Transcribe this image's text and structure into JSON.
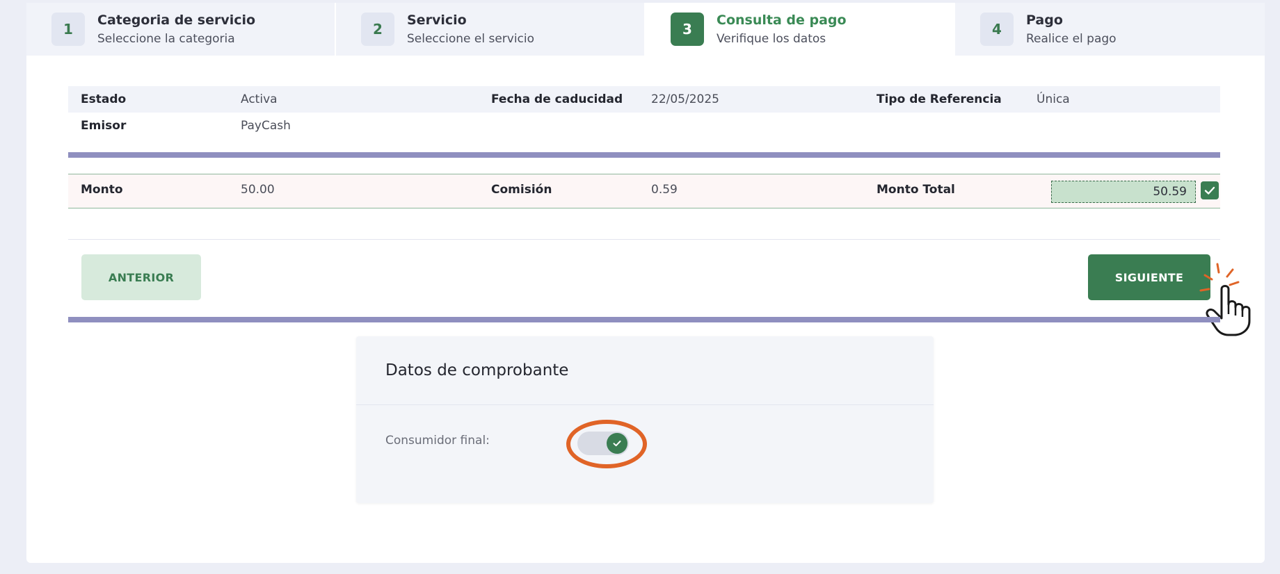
{
  "steps": [
    {
      "num": "1",
      "title": "Categoria de servicio",
      "subtitle": "Seleccione la categoria"
    },
    {
      "num": "2",
      "title": "Servicio",
      "subtitle": "Seleccione el servicio"
    },
    {
      "num": "3",
      "title": "Consulta de pago",
      "subtitle": "Verifique los datos"
    },
    {
      "num": "4",
      "title": "Pago",
      "subtitle": "Realice el pago"
    }
  ],
  "info": {
    "estado_label": "Estado",
    "estado_value": "Activa",
    "fecha_label": "Fecha de caducidad",
    "fecha_value": "22/05/2025",
    "tipo_label": "Tipo de Referencia",
    "tipo_value": "Única",
    "emisor_label": "Emisor",
    "emisor_value": "PayCash"
  },
  "amounts": {
    "monto_label": "Monto",
    "monto_value": "50.00",
    "comision_label": "Comisión",
    "comision_value": "0.59",
    "total_label": "Monto Total",
    "total_value": "50.59"
  },
  "buttons": {
    "prev_label": "ANTERIOR",
    "next_label": "SIGUIENTE"
  },
  "comprobante": {
    "title": "Datos de comprobante",
    "consumidor_label": "Consumidor final:",
    "consumidor_checked": true
  },
  "colors": {
    "accent_green": "#3a7d52",
    "divider_purple": "#8f8fbf",
    "highlight_orange": "#e06427"
  },
  "icons": {
    "total_check": "check-icon",
    "toggle_check": "check-icon",
    "cursor": "hand-pointer-icon"
  }
}
